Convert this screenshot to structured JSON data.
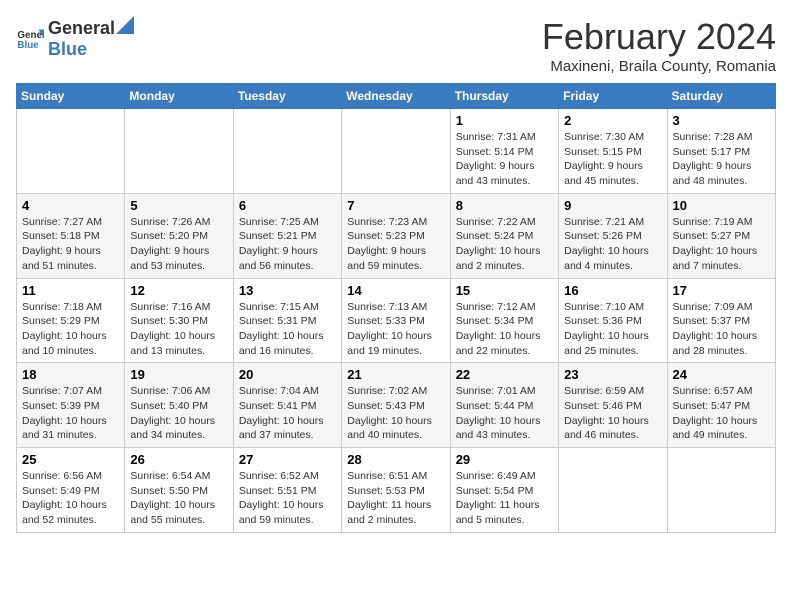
{
  "header": {
    "logo_general": "General",
    "logo_blue": "Blue",
    "month_title": "February 2024",
    "subtitle": "Maxineni, Braila County, Romania"
  },
  "days_of_week": [
    "Sunday",
    "Monday",
    "Tuesday",
    "Wednesday",
    "Thursday",
    "Friday",
    "Saturday"
  ],
  "weeks": [
    [
      {
        "day": "",
        "content": ""
      },
      {
        "day": "",
        "content": ""
      },
      {
        "day": "",
        "content": ""
      },
      {
        "day": "",
        "content": ""
      },
      {
        "day": "1",
        "content": "Sunrise: 7:31 AM\nSunset: 5:14 PM\nDaylight: 9 hours and 43 minutes."
      },
      {
        "day": "2",
        "content": "Sunrise: 7:30 AM\nSunset: 5:15 PM\nDaylight: 9 hours and 45 minutes."
      },
      {
        "day": "3",
        "content": "Sunrise: 7:28 AM\nSunset: 5:17 PM\nDaylight: 9 hours and 48 minutes."
      }
    ],
    [
      {
        "day": "4",
        "content": "Sunrise: 7:27 AM\nSunset: 5:18 PM\nDaylight: 9 hours and 51 minutes."
      },
      {
        "day": "5",
        "content": "Sunrise: 7:26 AM\nSunset: 5:20 PM\nDaylight: 9 hours and 53 minutes."
      },
      {
        "day": "6",
        "content": "Sunrise: 7:25 AM\nSunset: 5:21 PM\nDaylight: 9 hours and 56 minutes."
      },
      {
        "day": "7",
        "content": "Sunrise: 7:23 AM\nSunset: 5:23 PM\nDaylight: 9 hours and 59 minutes."
      },
      {
        "day": "8",
        "content": "Sunrise: 7:22 AM\nSunset: 5:24 PM\nDaylight: 10 hours and 2 minutes."
      },
      {
        "day": "9",
        "content": "Sunrise: 7:21 AM\nSunset: 5:26 PM\nDaylight: 10 hours and 4 minutes."
      },
      {
        "day": "10",
        "content": "Sunrise: 7:19 AM\nSunset: 5:27 PM\nDaylight: 10 hours and 7 minutes."
      }
    ],
    [
      {
        "day": "11",
        "content": "Sunrise: 7:18 AM\nSunset: 5:29 PM\nDaylight: 10 hours and 10 minutes."
      },
      {
        "day": "12",
        "content": "Sunrise: 7:16 AM\nSunset: 5:30 PM\nDaylight: 10 hours and 13 minutes."
      },
      {
        "day": "13",
        "content": "Sunrise: 7:15 AM\nSunset: 5:31 PM\nDaylight: 10 hours and 16 minutes."
      },
      {
        "day": "14",
        "content": "Sunrise: 7:13 AM\nSunset: 5:33 PM\nDaylight: 10 hours and 19 minutes."
      },
      {
        "day": "15",
        "content": "Sunrise: 7:12 AM\nSunset: 5:34 PM\nDaylight: 10 hours and 22 minutes."
      },
      {
        "day": "16",
        "content": "Sunrise: 7:10 AM\nSunset: 5:36 PM\nDaylight: 10 hours and 25 minutes."
      },
      {
        "day": "17",
        "content": "Sunrise: 7:09 AM\nSunset: 5:37 PM\nDaylight: 10 hours and 28 minutes."
      }
    ],
    [
      {
        "day": "18",
        "content": "Sunrise: 7:07 AM\nSunset: 5:39 PM\nDaylight: 10 hours and 31 minutes."
      },
      {
        "day": "19",
        "content": "Sunrise: 7:06 AM\nSunset: 5:40 PM\nDaylight: 10 hours and 34 minutes."
      },
      {
        "day": "20",
        "content": "Sunrise: 7:04 AM\nSunset: 5:41 PM\nDaylight: 10 hours and 37 minutes."
      },
      {
        "day": "21",
        "content": "Sunrise: 7:02 AM\nSunset: 5:43 PM\nDaylight: 10 hours and 40 minutes."
      },
      {
        "day": "22",
        "content": "Sunrise: 7:01 AM\nSunset: 5:44 PM\nDaylight: 10 hours and 43 minutes."
      },
      {
        "day": "23",
        "content": "Sunrise: 6:59 AM\nSunset: 5:46 PM\nDaylight: 10 hours and 46 minutes."
      },
      {
        "day": "24",
        "content": "Sunrise: 6:57 AM\nSunset: 5:47 PM\nDaylight: 10 hours and 49 minutes."
      }
    ],
    [
      {
        "day": "25",
        "content": "Sunrise: 6:56 AM\nSunset: 5:49 PM\nDaylight: 10 hours and 52 minutes."
      },
      {
        "day": "26",
        "content": "Sunrise: 6:54 AM\nSunset: 5:50 PM\nDaylight: 10 hours and 55 minutes."
      },
      {
        "day": "27",
        "content": "Sunrise: 6:52 AM\nSunset: 5:51 PM\nDaylight: 10 hours and 59 minutes."
      },
      {
        "day": "28",
        "content": "Sunrise: 6:51 AM\nSunset: 5:53 PM\nDaylight: 11 hours and 2 minutes."
      },
      {
        "day": "29",
        "content": "Sunrise: 6:49 AM\nSunset: 5:54 PM\nDaylight: 11 hours and 5 minutes."
      },
      {
        "day": "",
        "content": ""
      },
      {
        "day": "",
        "content": ""
      }
    ]
  ]
}
